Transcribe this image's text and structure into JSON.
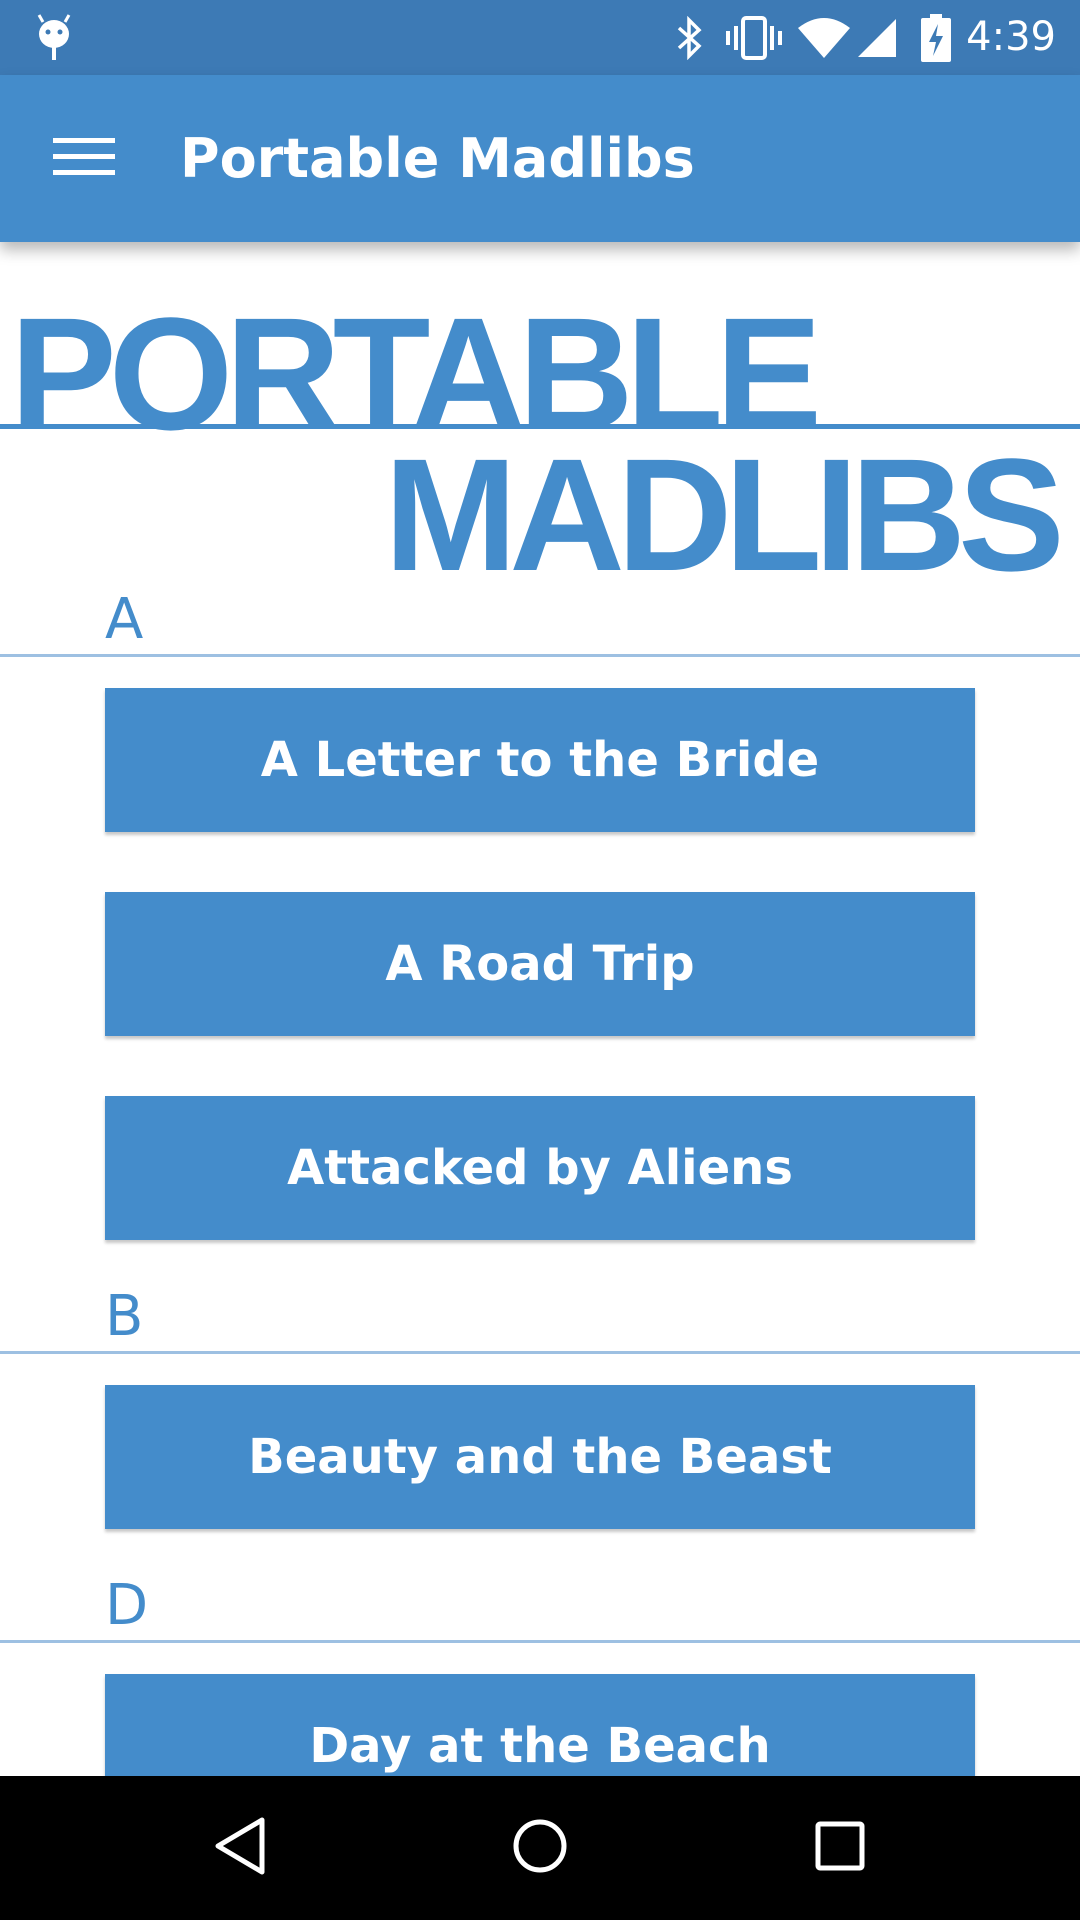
{
  "status_bar": {
    "time": "4:39",
    "icons": [
      "android-debug-icon",
      "bluetooth-icon",
      "vibrate-icon",
      "wifi-icon",
      "cell-signal-icon",
      "battery-charging-icon"
    ],
    "background": "#3d7ab5"
  },
  "app_bar": {
    "title": "Portable Madlibs",
    "menu_icon": "hamburger-menu-icon",
    "background": "#448ccb"
  },
  "logo": {
    "line1": "PORTABLE",
    "line2": "MADLIBS",
    "color": "#448ccb"
  },
  "sections": [
    {
      "letter": "A",
      "stories": [
        "A Letter to the Bride",
        "A Road Trip",
        "Attacked by Aliens"
      ]
    },
    {
      "letter": "B",
      "stories": [
        "Beauty and the Beast"
      ]
    },
    {
      "letter": "D",
      "stories": [
        "Day at the Beach"
      ]
    }
  ],
  "nav_bar": {
    "buttons": [
      "back-icon",
      "home-icon",
      "recents-icon"
    ]
  },
  "colors": {
    "accent": "#448ccb",
    "divider": "#9dc0e2",
    "button_text": "#ffffff"
  }
}
